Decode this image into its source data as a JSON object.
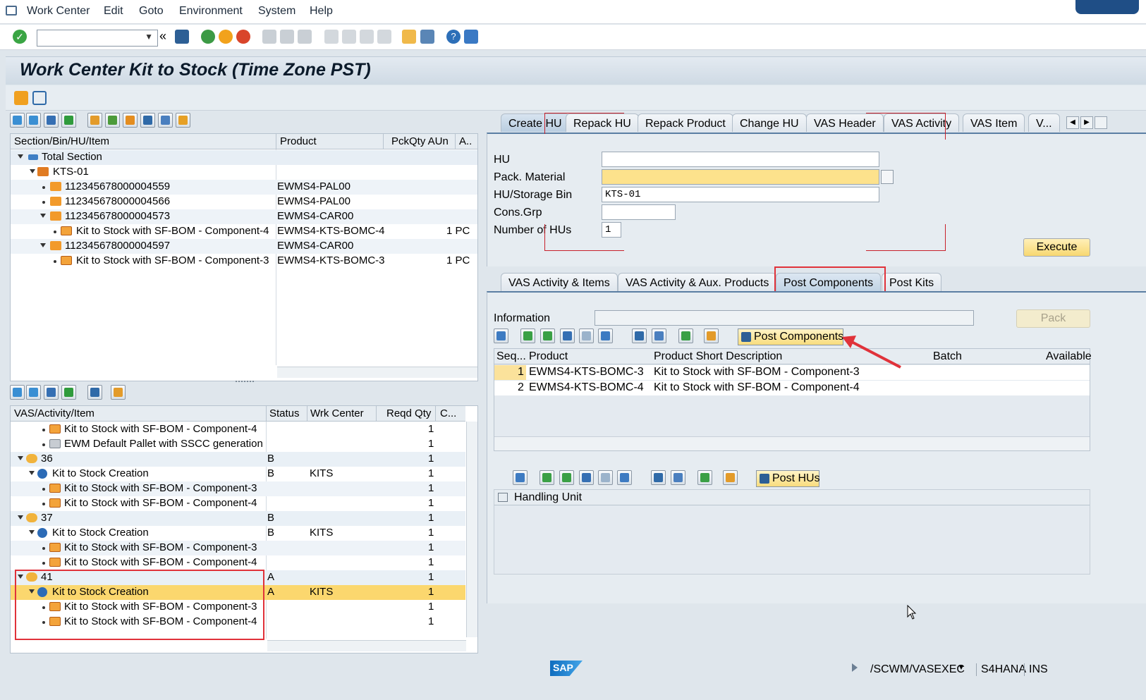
{
  "menu": [
    "Work Center",
    "Edit",
    "Goto",
    "Environment",
    "System",
    "Help"
  ],
  "title": "Work Center Kit to Stock (Time Zone PST)",
  "upper_tree": {
    "columns": [
      "Section/Bin/HU/Item",
      "Product",
      "PckQty AUn",
      "A.."
    ],
    "rows": [
      {
        "label": "Total Section",
        "product": "",
        "qty": ""
      },
      {
        "label": "KTS-01",
        "product": "",
        "qty": ""
      },
      {
        "label": "112345678000004559",
        "product": "EWMS4-PAL00",
        "qty": ""
      },
      {
        "label": "112345678000004566",
        "product": "EWMS4-PAL00",
        "qty": ""
      },
      {
        "label": "112345678000004573",
        "product": "EWMS4-CAR00",
        "qty": ""
      },
      {
        "label": "Kit to Stock with SF-BOM - Component-4",
        "product": "EWMS4-KTS-BOMC-4",
        "qty": "1 PC"
      },
      {
        "label": "112345678000004597",
        "product": "EWMS4-CAR00",
        "qty": ""
      },
      {
        "label": "Kit to Stock with SF-BOM - Component-3",
        "product": "EWMS4-KTS-BOMC-3",
        "qty": "1 PC"
      }
    ]
  },
  "lower_tree": {
    "columns": [
      "VAS/Activity/Item",
      "Status",
      "Wrk Center",
      "Reqd Qty",
      "C..."
    ],
    "rows": [
      {
        "label": "Kit to Stock with SF-BOM - Component-4",
        "status": "",
        "wc": "",
        "qty": "1"
      },
      {
        "label": "EWM Default Pallet with SSCC generation",
        "status": "",
        "wc": "",
        "qty": "1"
      },
      {
        "label": "36",
        "status": "B",
        "wc": "",
        "qty": "1"
      },
      {
        "label": "Kit to Stock Creation",
        "status": "B",
        "wc": "KITS",
        "qty": "1"
      },
      {
        "label": "Kit to Stock with SF-BOM - Component-3",
        "status": "",
        "wc": "",
        "qty": "1"
      },
      {
        "label": "Kit to Stock with SF-BOM - Component-4",
        "status": "",
        "wc": "",
        "qty": "1"
      },
      {
        "label": "37",
        "status": "B",
        "wc": "",
        "qty": "1"
      },
      {
        "label": "Kit to Stock Creation",
        "status": "B",
        "wc": "KITS",
        "qty": "1"
      },
      {
        "label": "Kit to Stock with SF-BOM - Component-3",
        "status": "",
        "wc": "",
        "qty": "1"
      },
      {
        "label": "Kit to Stock with SF-BOM - Component-4",
        "status": "",
        "wc": "",
        "qty": "1"
      },
      {
        "label": "41",
        "status": "A",
        "wc": "",
        "qty": "1"
      },
      {
        "label": "Kit to Stock Creation",
        "status": "A",
        "wc": "KITS",
        "qty": "1"
      },
      {
        "label": "Kit to Stock with SF-BOM - Component-3",
        "status": "",
        "wc": "",
        "qty": "1"
      },
      {
        "label": "Kit to Stock with SF-BOM - Component-4",
        "status": "",
        "wc": "",
        "qty": "1"
      }
    ]
  },
  "top_tabs": [
    "Create HU",
    "Repack HU",
    "Repack Product",
    "Change HU",
    "VAS Header",
    "VAS Activity",
    "VAS Item",
    "V..."
  ],
  "form": {
    "hu_label": "HU",
    "hu_value": "",
    "pack_label": "Pack. Material",
    "pack_value": "",
    "bin_label": "HU/Storage Bin",
    "bin_value": "KTS-01",
    "cons_label": "Cons.Grp",
    "cons_value": "",
    "num_label": "Number of HUs",
    "num_value": "1",
    "execute": "Execute"
  },
  "bottom_tabs": [
    "VAS Activity & Items",
    "VAS Activity & Aux. Products",
    "Post Components",
    "Post Kits"
  ],
  "info": {
    "label": "Information",
    "value": "",
    "pack": "Pack"
  },
  "post_components_btn": "Post Components",
  "components_grid": {
    "columns": [
      "Seq...",
      "Product",
      "Product Short Description",
      "Batch",
      "Available"
    ],
    "rows": [
      {
        "seq": "1",
        "product": "EWMS4-KTS-BOMC-3",
        "desc": "Kit to Stock with SF-BOM - Component-3"
      },
      {
        "seq": "2",
        "product": "EWMS4-KTS-BOMC-4",
        "desc": "Kit to Stock with SF-BOM - Component-4"
      }
    ]
  },
  "post_hus_btn": "Post HUs",
  "hu_grid": {
    "column": "Handling Unit"
  },
  "status": {
    "transaction": "/SCWM/VASEXEC",
    "system": "S4HANA",
    "mode": "INS",
    "logo": "SAP"
  }
}
